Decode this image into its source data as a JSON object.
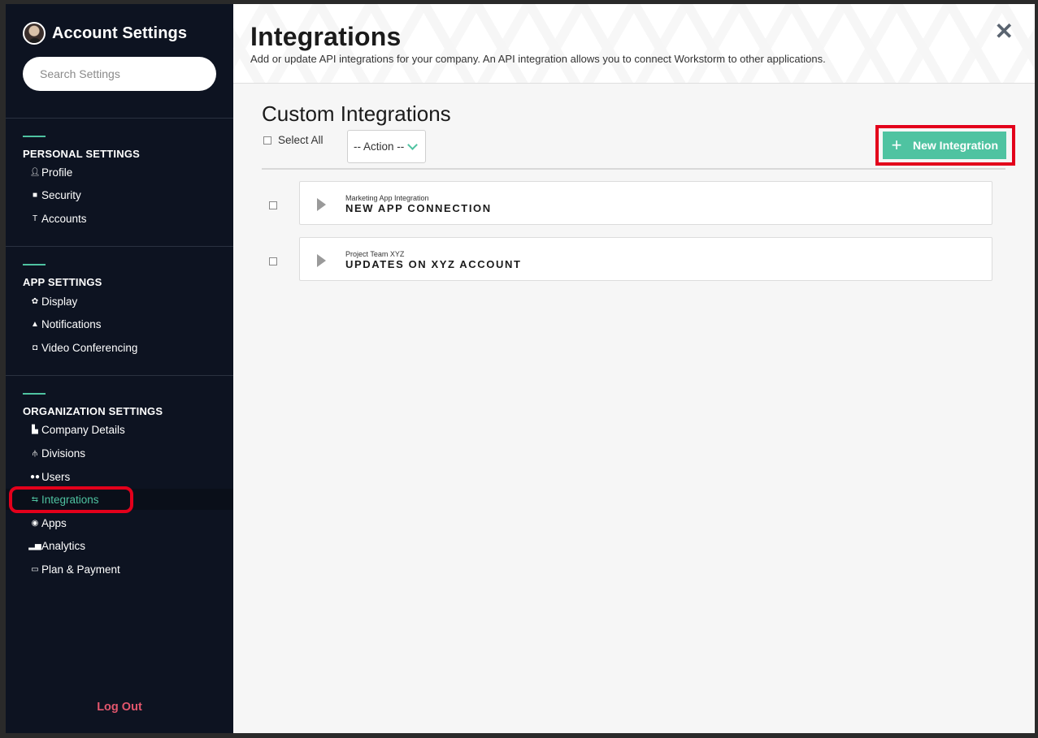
{
  "sidebar": {
    "title": "Account Settings",
    "search_placeholder": "Search Settings",
    "sections": [
      {
        "title": "PERSONAL SETTINGS",
        "items": [
          {
            "label": "Profile",
            "icon": "person-icon"
          },
          {
            "label": "Security",
            "icon": "lock-icon"
          },
          {
            "label": "Accounts",
            "icon": "accounts-icon"
          }
        ]
      },
      {
        "title": "APP SETTINGS",
        "items": [
          {
            "label": "Display",
            "icon": "gear-icon"
          },
          {
            "label": "Notifications",
            "icon": "bell-icon"
          },
          {
            "label": "Video Conferencing",
            "icon": "camera-icon"
          }
        ]
      },
      {
        "title": "ORGANIZATION SETTINGS",
        "items": [
          {
            "label": "Company Details",
            "icon": "building-icon"
          },
          {
            "label": "Divisions",
            "icon": "hierarchy-icon"
          },
          {
            "label": "Users",
            "icon": "users-icon"
          },
          {
            "label": "Integrations",
            "icon": "swap-arrows-icon",
            "active": true
          },
          {
            "label": "Apps",
            "icon": "apps-icon"
          },
          {
            "label": "Analytics",
            "icon": "bar-chart-icon"
          },
          {
            "label": "Plan & Payment",
            "icon": "credit-card-icon"
          }
        ]
      }
    ],
    "logout": "Log Out"
  },
  "header": {
    "title": "Integrations",
    "subtitle": "Add or update API integrations for your company. An API integration allows you to connect Workstorm to other applications.",
    "close": "✕"
  },
  "content": {
    "title": "Custom Integrations",
    "select_all": "Select All",
    "action_value": "-- Action --",
    "new_button": "New Integration",
    "integrations": [
      {
        "subtitle": "Marketing App Integration",
        "name": "NEW APP CONNECTION"
      },
      {
        "subtitle": "Project Team XYZ",
        "name": "UPDATES ON XYZ ACCOUNT"
      }
    ]
  },
  "colors": {
    "accent": "#4fc3a1",
    "sidebar_bg": "#0d1321",
    "logout": "#e3566d",
    "highlight": "#e3001b"
  }
}
